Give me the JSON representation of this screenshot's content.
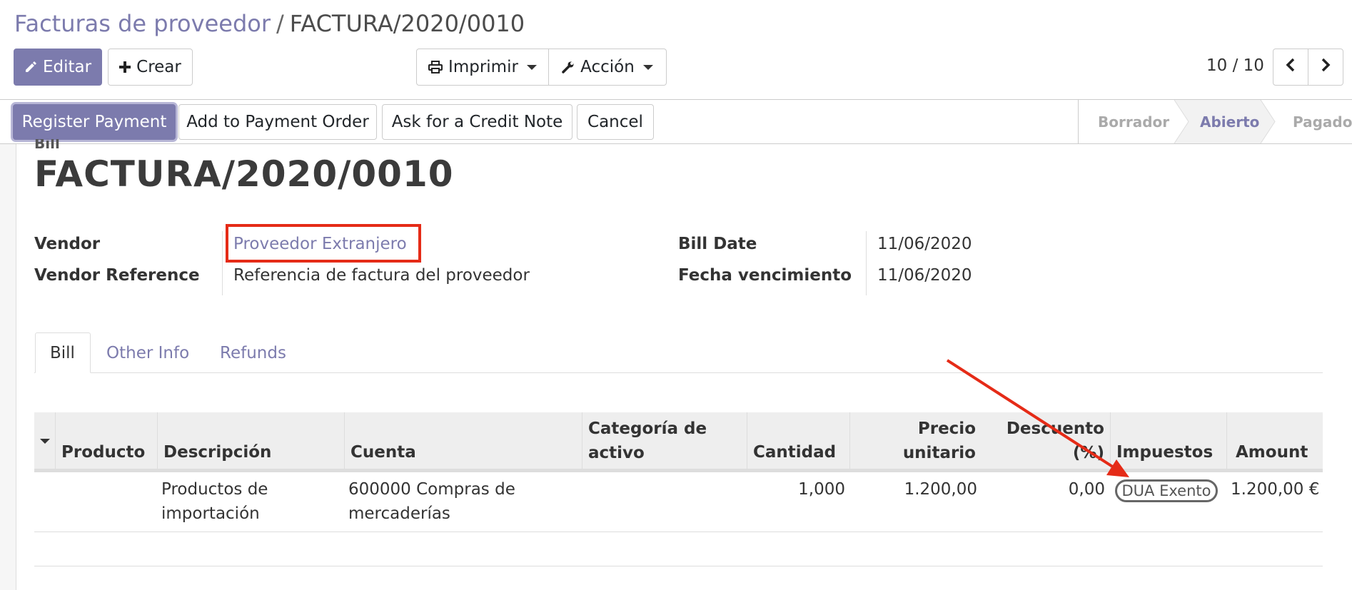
{
  "breadcrumb": {
    "parent": "Facturas de proveedor",
    "separator": "/",
    "current": "FACTURA/2020/0010"
  },
  "toolbar": {
    "edit_label": "Editar",
    "create_label": "Crear",
    "print_label": "Imprimir",
    "action_label": "Acción"
  },
  "pager": {
    "value": "10 / 10"
  },
  "statusbar": {
    "register_payment": "Register Payment",
    "add_payment_order": "Add to Payment Order",
    "credit_note": "Ask for a Credit Note",
    "cancel": "Cancel",
    "stages": [
      "Borrador",
      "Abierto",
      "Pagado"
    ],
    "active_stage": "Abierto"
  },
  "document": {
    "type": "Bill",
    "title": "FACTURA/2020/0010"
  },
  "fields": {
    "vendor_label": "Vendor",
    "vendor_value": "Proveedor Extranjero",
    "vendor_ref_label": "Vendor Reference",
    "vendor_ref_value": "Referencia de factura del proveedor",
    "bill_date_label": "Bill Date",
    "bill_date_value": "11/06/2020",
    "due_date_label": "Fecha vencimiento",
    "due_date_value": "11/06/2020"
  },
  "tabs": [
    "Bill",
    "Other Info",
    "Refunds"
  ],
  "table": {
    "headers": {
      "product": "Producto",
      "description": "Descripción",
      "account": "Cuenta",
      "asset_category_1": "Categoría de",
      "asset_category_2": "activo",
      "quantity": "Cantidad",
      "unit_price_1": "Precio",
      "unit_price_2": "unitario",
      "discount_1": "Descuento",
      "discount_2": "(%)",
      "taxes": "Impuestos",
      "amount": "Amount"
    },
    "rows": [
      {
        "product": "",
        "description_1": "Productos de",
        "description_2": "importación",
        "account_1": "600000 Compras de",
        "account_2": "mercaderías",
        "asset_category": "",
        "quantity": "1,000",
        "unit_price": "1.200,00",
        "discount": "0,00",
        "tax": "DUA Exento",
        "amount": "1.200,00 €"
      }
    ]
  },
  "colors": {
    "primary": "#7c7bad",
    "annotation_red": "#e52b17"
  }
}
